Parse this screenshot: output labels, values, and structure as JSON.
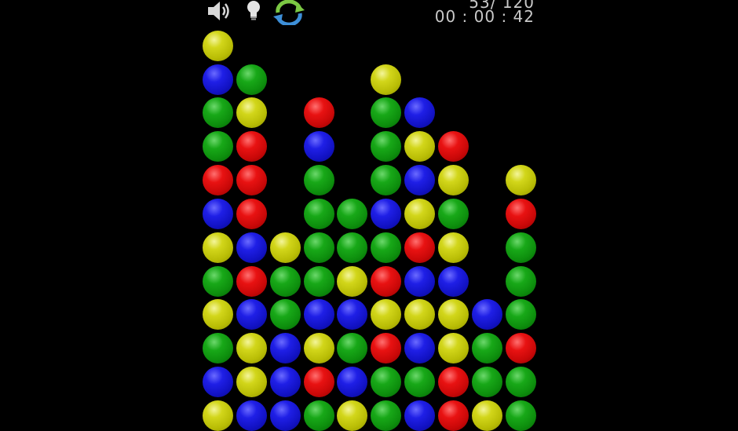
{
  "hud": {
    "score": "53/ 120",
    "timer": "00 : 00 : 42"
  },
  "toolbar": {
    "sound_icon": "speaker-icon",
    "hint_icon": "lightbulb-icon",
    "restart_icon": "refresh-icon"
  },
  "colors": {
    "yellow": "#c8cc10",
    "blue": "#1818d8",
    "green": "#12a012",
    "red": "#dd0e0e"
  },
  "board": {
    "columns": [
      [
        "yellow",
        "blue",
        "green",
        "yellow",
        "green",
        "yellow",
        "blue",
        "red",
        "green",
        "green",
        "blue",
        "yellow"
      ],
      [
        "blue",
        "yellow",
        "yellow",
        "blue",
        "red",
        "blue",
        "red",
        "red",
        "red",
        "yellow",
        "green"
      ],
      [
        "blue",
        "blue",
        "blue",
        "green",
        "green",
        "yellow"
      ],
      [
        "green",
        "red",
        "yellow",
        "blue",
        "green",
        "green",
        "green",
        "green",
        "blue",
        "red"
      ],
      [
        "yellow",
        "blue",
        "green",
        "blue",
        "yellow",
        "green",
        "green"
      ],
      [
        "green",
        "green",
        "red",
        "yellow",
        "red",
        "green",
        "blue",
        "green",
        "green",
        "green",
        "yellow"
      ],
      [
        "blue",
        "green",
        "blue",
        "yellow",
        "blue",
        "red",
        "yellow",
        "blue",
        "yellow",
        "blue"
      ],
      [
        "red",
        "red",
        "yellow",
        "yellow",
        "blue",
        "yellow",
        "green",
        "yellow",
        "red"
      ],
      [
        "yellow",
        "green",
        "green",
        "blue"
      ],
      [
        "green",
        "green",
        "red",
        "green",
        "green",
        "green",
        "red",
        "yellow"
      ]
    ]
  }
}
